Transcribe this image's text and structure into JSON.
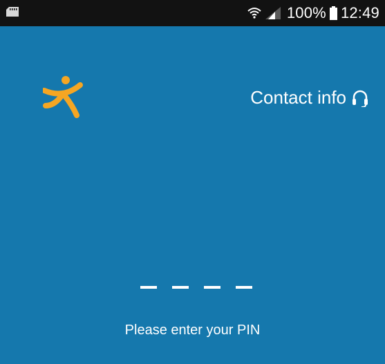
{
  "status_bar": {
    "battery_percent": "100%",
    "time": "12:49",
    "icons": [
      "sd-card-icon",
      "wifi-icon",
      "signal-icon",
      "battery-icon"
    ]
  },
  "header": {
    "logo_icon": "person-figure-logo",
    "contact_label": "Contact info",
    "contact_icon": "headset-icon"
  },
  "pin": {
    "length": 4,
    "prompt": "Please enter your PIN"
  },
  "colors": {
    "status_bar": "#121212",
    "background": "#1578ad",
    "logo": "#f5a623",
    "text": "#ffffff"
  }
}
